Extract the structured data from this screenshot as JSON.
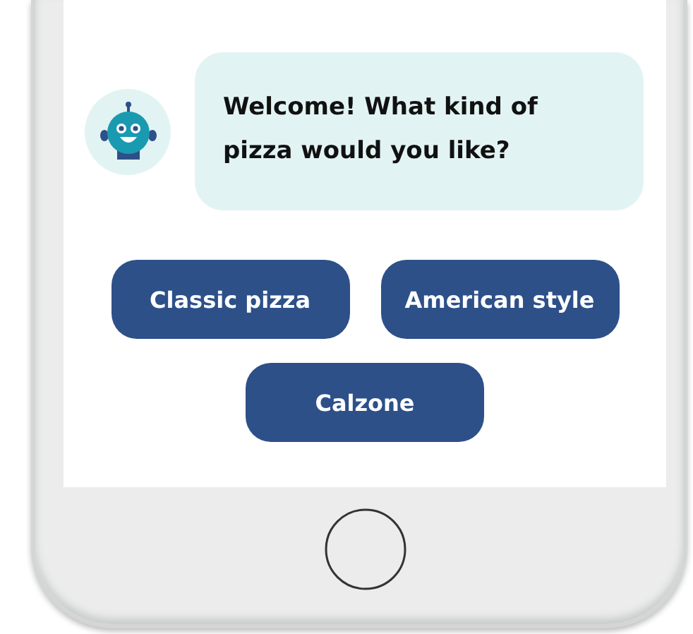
{
  "chat": {
    "message": {
      "text": "Welcome! What kind of pizza would you like?"
    }
  },
  "quick_replies": [
    {
      "label": "Classic pizza"
    },
    {
      "label": "American style"
    },
    {
      "label": "Calzone"
    }
  ]
}
